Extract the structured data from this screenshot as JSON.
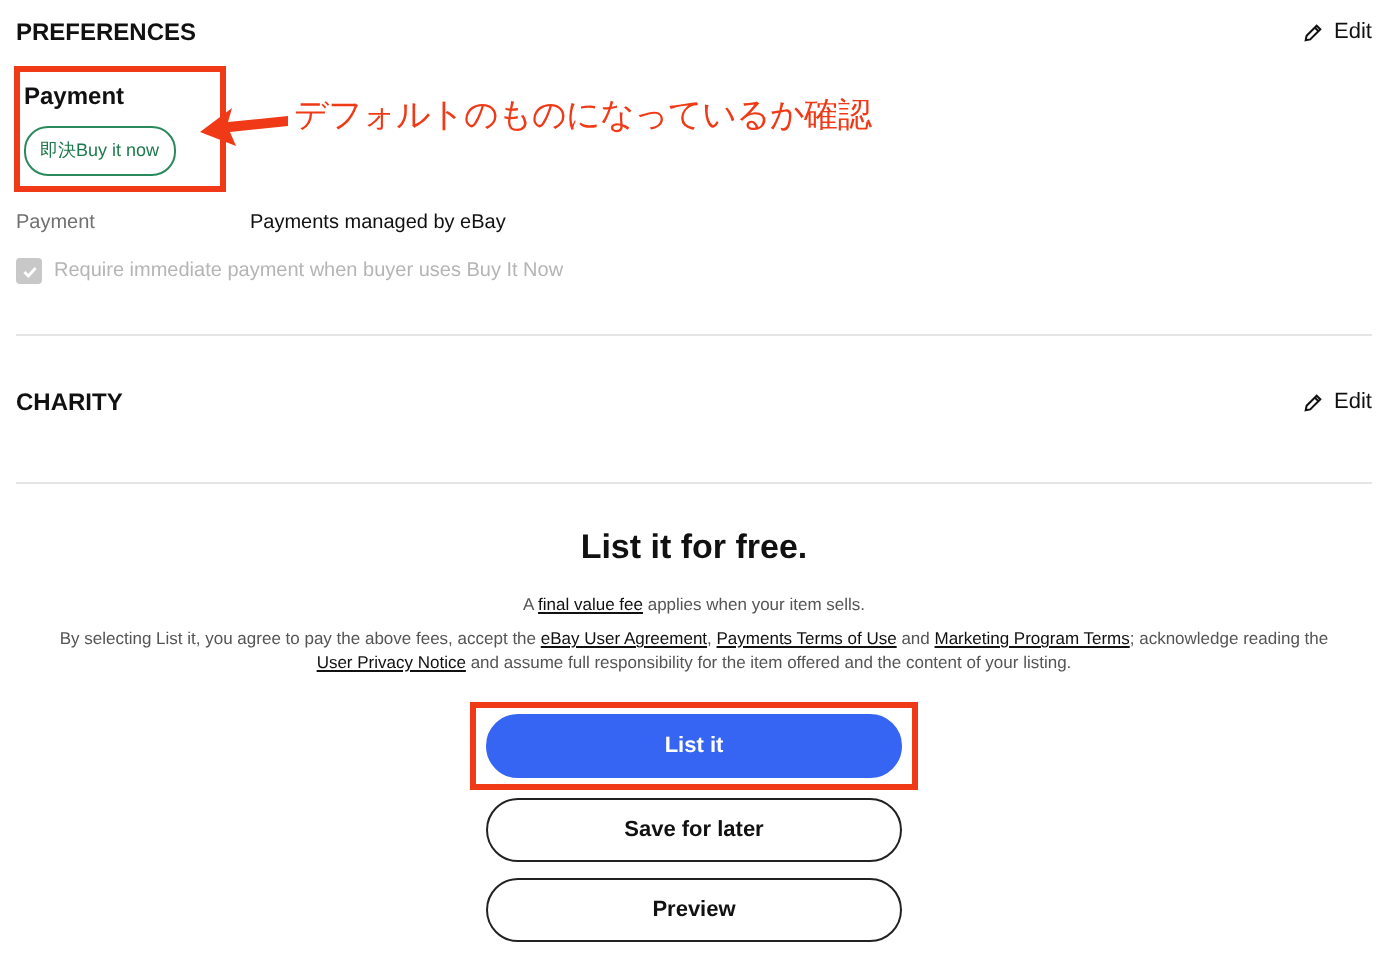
{
  "preferences": {
    "title": "PREFERENCES",
    "edit": "Edit",
    "payment_heading": "Payment",
    "payment_chip": "即決Buy it now",
    "payment_highlighted": true,
    "payment_row": {
      "label": "Payment",
      "value": "Payments managed by eBay"
    },
    "immediate_payment": {
      "label": "Require immediate payment when buyer uses Buy It Now",
      "checked": true,
      "disabled": true
    }
  },
  "annotation": {
    "text": "デフォルトのものになっているか確認"
  },
  "charity": {
    "title": "CHARITY",
    "edit": "Edit"
  },
  "listing": {
    "title": "List it for free.",
    "fee_note": [
      {
        "kind": "text",
        "text": "A "
      },
      {
        "kind": "link",
        "text": "final value fee"
      },
      {
        "kind": "text",
        "text": " applies when your item sells."
      }
    ],
    "agreement": [
      {
        "kind": "text",
        "text": "By selecting List it, you agree to pay the above fees, accept the "
      },
      {
        "kind": "link",
        "text": "eBay User Agreement"
      },
      {
        "kind": "text",
        "text": ", "
      },
      {
        "kind": "link",
        "text": "Payments Terms of Use"
      },
      {
        "kind": "text",
        "text": " and "
      },
      {
        "kind": "link",
        "text": "Marketing Program Terms"
      },
      {
        "kind": "text",
        "text": "; acknowledge reading the "
      },
      {
        "kind": "link",
        "text": "User Privacy Notice"
      },
      {
        "kind": "text",
        "text": " and assume full responsibility for the item offered and the content of your listing."
      }
    ],
    "buttons": [
      {
        "label": "List it",
        "kind": "primary",
        "highlighted": true
      },
      {
        "label": "Save for later",
        "kind": "secondary",
        "highlighted": false
      },
      {
        "label": "Preview",
        "kind": "secondary",
        "highlighted": false
      }
    ]
  }
}
